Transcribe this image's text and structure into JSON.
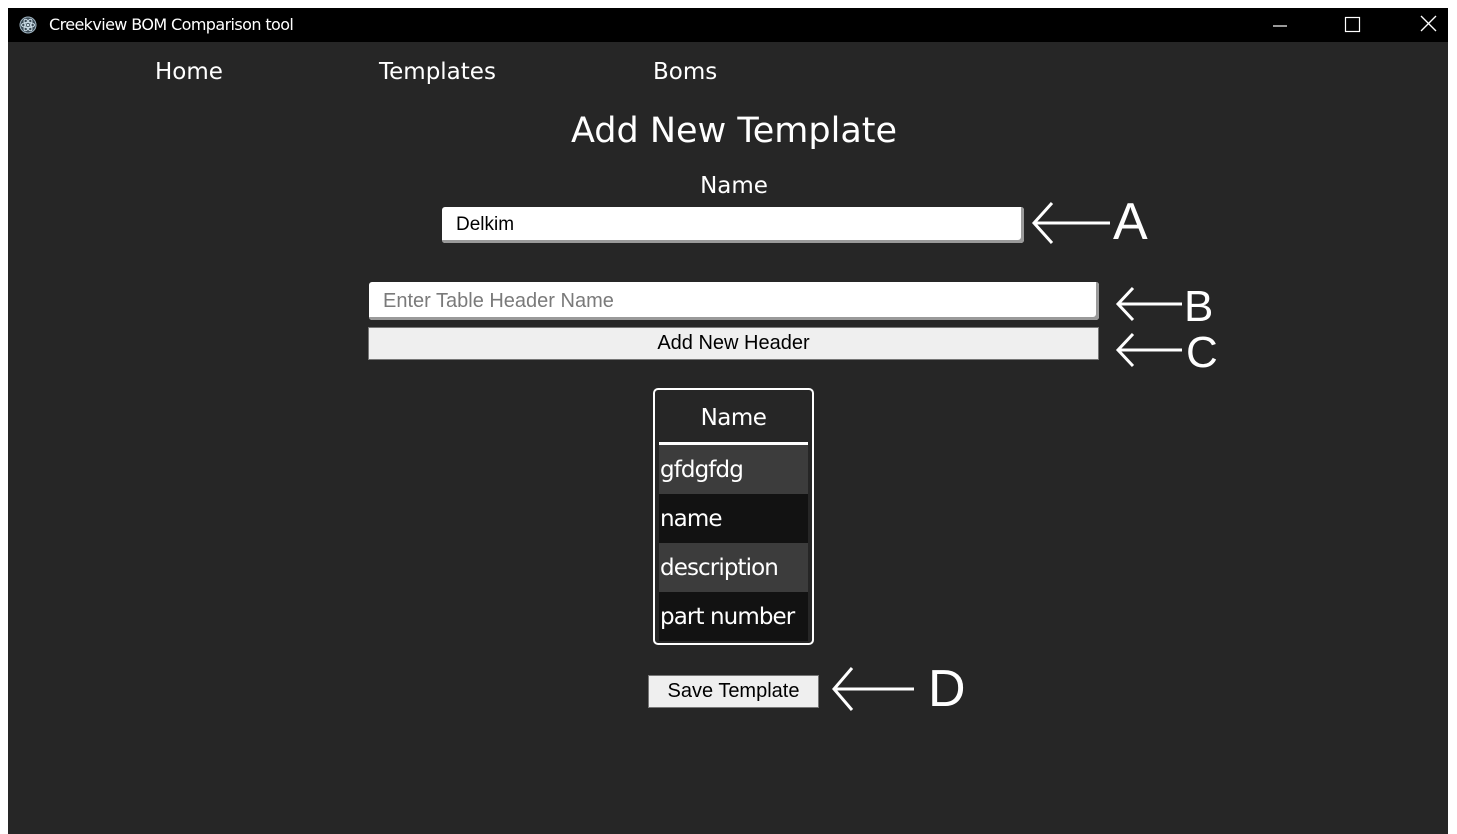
{
  "window": {
    "title": "Creekview BOM Comparison tool",
    "controls": [
      "minimize-icon",
      "maximize-icon",
      "close-icon"
    ]
  },
  "nav": {
    "home": "Home",
    "templates": "Templates",
    "boms": "Boms"
  },
  "page": {
    "title": "Add New Template",
    "name_label": "Name",
    "name_value": "Delkim",
    "header_placeholder": "Enter Table Header Name",
    "add_header_button": "Add New Header",
    "save_button": "Save Template"
  },
  "headers_table": {
    "column": "Name",
    "rows": [
      "gfdgfdg",
      "name",
      "description",
      "part number"
    ]
  },
  "annotations": [
    "A",
    "B",
    "C",
    "D"
  ],
  "colors": {
    "background": "#262626",
    "titlebar": "#000000",
    "text": "#ffffff",
    "row_light": "#3c3c3c",
    "row_dark": "#121212",
    "button": "#efefef"
  }
}
